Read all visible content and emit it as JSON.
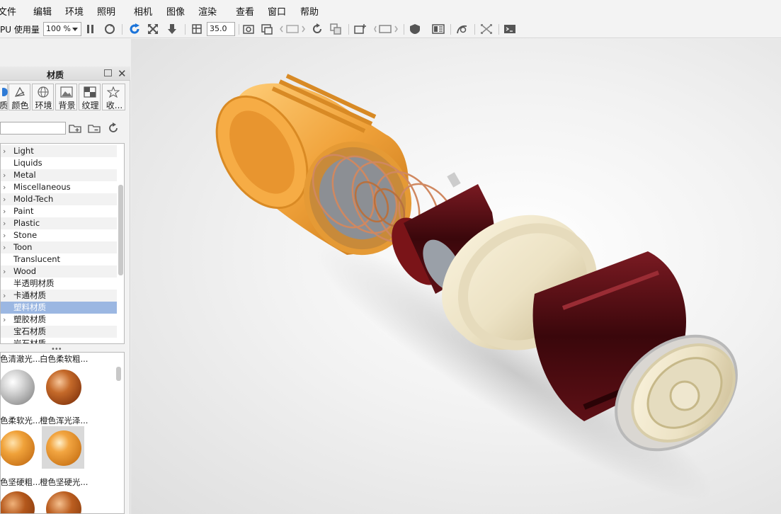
{
  "menu": [
    "文件",
    "编辑",
    "环境",
    "照明",
    "相机",
    "图像",
    "渲染",
    "查看",
    "窗口",
    "帮助"
  ],
  "toolbar": {
    "gpu_label": "PU 使用量",
    "gpu_value": "100 %",
    "fov_value": "35.0"
  },
  "panel": {
    "title": "材质",
    "tabs": [
      "质",
      "颜色",
      "环境",
      "背景",
      "纹理",
      "收..."
    ],
    "tree_items": [
      {
        "label": "Light",
        "expandable": true
      },
      {
        "label": "Liquids",
        "expandable": false
      },
      {
        "label": "Metal",
        "expandable": true
      },
      {
        "label": "Miscellaneous",
        "expandable": true
      },
      {
        "label": "Mold-Tech",
        "expandable": true
      },
      {
        "label": "Paint",
        "expandable": true
      },
      {
        "label": "Plastic",
        "expandable": true
      },
      {
        "label": "Stone",
        "expandable": true
      },
      {
        "label": "Toon",
        "expandable": true
      },
      {
        "label": "Translucent",
        "expandable": false
      },
      {
        "label": "Wood",
        "expandable": true
      },
      {
        "label": "半透明材质",
        "expandable": false
      },
      {
        "label": "卡通材质",
        "expandable": true
      },
      {
        "label": "塑料材质",
        "expandable": false,
        "selected": true
      },
      {
        "label": "塑胶材质",
        "expandable": true
      },
      {
        "label": "宝石材质",
        "expandable": false
      },
      {
        "label": "岩石材质",
        "expandable": false
      }
    ],
    "thumb_labels_row1": [
      "色清澈光...",
      "白色柔软粗..."
    ],
    "thumb_labels_row2": [
      "色柔软光...",
      "橙色浑光泽..."
    ],
    "thumb_labels_row3": [
      "色坚硬粗...",
      "橙色坚硬光..."
    ]
  },
  "colors": {
    "selection": "#9bb7e2",
    "orange": "#f0a23a",
    "cream": "#ece2c4",
    "dark_red": "#4a0c10"
  }
}
